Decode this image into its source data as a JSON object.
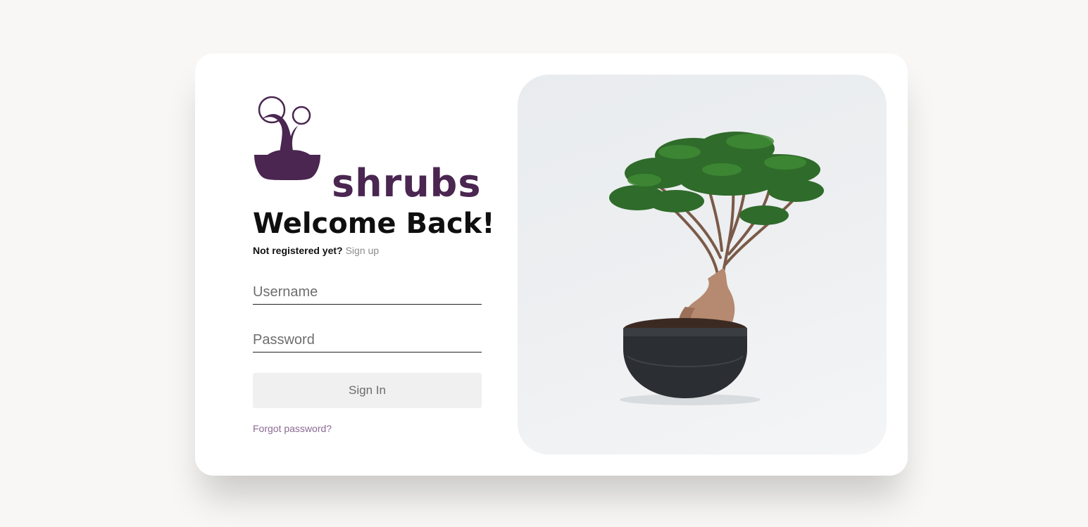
{
  "brand": {
    "name": "shrubs",
    "color": "#4a2651"
  },
  "login": {
    "title": "Welcome Back!",
    "not_registered": "Not registered yet?",
    "signup_link": "Sign up",
    "username_placeholder": "Username",
    "password_placeholder": "Password",
    "signin_label": "Sign In",
    "forgot_label": "Forgot password?"
  },
  "image": {
    "subject": "bonsai-plant-in-black-pot"
  },
  "colors": {
    "page_bg": "#f8f7f5",
    "card_bg": "#ffffff",
    "button_bg": "#f0f0f0",
    "link_muted": "#8c8c8c",
    "forgot_link": "#8a6a93"
  }
}
